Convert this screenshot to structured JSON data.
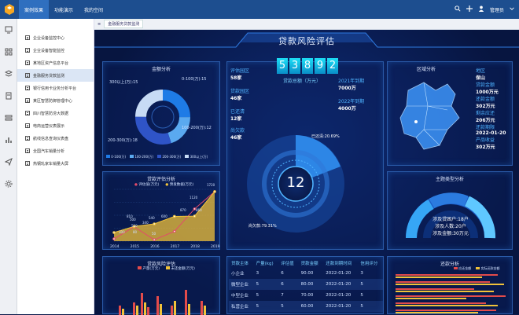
{
  "topbar": {
    "tabs": [
      {
        "label": "案例效果"
      },
      {
        "label": "功能演示"
      },
      {
        "label": "我的空间"
      }
    ],
    "user": "管理员"
  },
  "sidebar": {
    "items": [
      {
        "label": "企业设备监控中心"
      },
      {
        "label": "企业设备智能监控"
      },
      {
        "label": "某地区资产信息平台"
      },
      {
        "label": "金融服务贷款监测"
      },
      {
        "label": "银行信用卡业务分析平台"
      },
      {
        "label": "某区智慧防御管理中心"
      },
      {
        "label": "四川智慧防涝大数据"
      },
      {
        "label": "电商运营仪表展示"
      },
      {
        "label": "航线信息查询仪表盘"
      },
      {
        "label": "全国汽车销量分析"
      },
      {
        "label": "热钢轧家车销量大屏"
      }
    ]
  },
  "crumb": {
    "tab": "金融服务贷款监测"
  },
  "dashboard": {
    "title": "贷款风险评估",
    "total": {
      "digits": [
        "5",
        "3",
        "8",
        "9",
        "2"
      ],
      "label": "贷款总额（万元）"
    },
    "left_stats": [
      {
        "k": "评估园区",
        "v": "58家"
      },
      {
        "k": "贷款园区",
        "v": "46家"
      },
      {
        "k": "已还清",
        "v": "12家"
      },
      {
        "k": "尚欠款",
        "v": "46家"
      }
    ],
    "right_stats": [
      {
        "k": "2021年到期",
        "v": "7000万"
      },
      {
        "k": "2022年到期",
        "v": "4000万"
      }
    ],
    "center": {
      "value": "12",
      "paid": "已还清:20.69%",
      "owed": "尚欠款:79.31%"
    },
    "region": {
      "title": "区域分析",
      "stats": [
        {
          "k": "地区",
          "v": "保山"
        },
        {
          "k": "贷款金额",
          "v": "1000万元"
        },
        {
          "k": "还款金额",
          "v": "302万元"
        },
        {
          "k": "剩余应还",
          "v": "206万元"
        },
        {
          "k": "还款期限",
          "v": "2022-01-20"
        },
        {
          "k": "产品收益",
          "v": "302万元"
        }
      ]
    },
    "amount_panel": {
      "title": "金额分析",
      "labels": [
        "300以上(万):15",
        "0-100(万):15",
        "200-300(万):18",
        "100-200(万):12"
      ],
      "legend": [
        "0-100(万)",
        "100-200(万)",
        "200-300(万)",
        "300以上(万)"
      ]
    },
    "topic_panel": {
      "title": "主题类型分析",
      "lines": [
        "涉及贷困户:18户",
        "涉及人数:20户",
        "涉及金额:30万元"
      ]
    },
    "eval_panel": {
      "title": "贷款评估分析",
      "legend": [
        "评估值(万元)",
        "预发数据(万元)"
      ]
    },
    "risk_panel": {
      "title": "贷款风险评估",
      "legend": [
        "产量(万元)",
        "未还金额(万元)"
      ]
    },
    "repay_panel": {
      "title": "还款分析",
      "legend": [
        "应还金额",
        "实际还款金额"
      ]
    },
    "table": {
      "headers": [
        "贷款主体",
        "产量(kg)",
        "评估值",
        "贷款金额",
        "还款到期时间",
        "信用评分"
      ],
      "rows": [
        [
          "小企业",
          "3",
          "6",
          "90.00",
          "2022-01-20",
          "3"
        ],
        [
          "微型企业",
          "5",
          "6",
          "80.00",
          "2022-01-20",
          "5"
        ],
        [
          "中型企业",
          "5",
          "7",
          "70.00",
          "2022-01-20",
          "5"
        ],
        [
          "私营企业",
          "5",
          "5",
          "60.00",
          "2022-01-20",
          "5"
        ]
      ]
    }
  },
  "chart_data": [
    {
      "type": "line",
      "title": "贷款评估分析",
      "categories": [
        "2014",
        "2015",
        "2016",
        "2017",
        "2018",
        "2019"
      ],
      "series": [
        {
          "name": "评估值(万元)",
          "values": [
            80,
            500,
            50,
            340,
            1120,
            1720
          ]
        },
        {
          "name": "预发数据(万元)",
          "values": [
            300,
            510,
            600,
            860,
            870,
            1720
          ]
        }
      ],
      "value_labels": [
        "1720",
        "1120",
        "860",
        "870",
        "600",
        "540",
        "340",
        "500",
        "810",
        "510",
        "300",
        "80",
        "50"
      ],
      "ylim": [
        0,
        1800
      ]
    },
    {
      "type": "pie",
      "title": "金额分析",
      "labels": [
        "300以上(万)",
        "0-100(万)",
        "200-300(万)",
        "100-200(万)"
      ],
      "values": [
        15,
        15,
        18,
        12
      ]
    }
  ]
}
